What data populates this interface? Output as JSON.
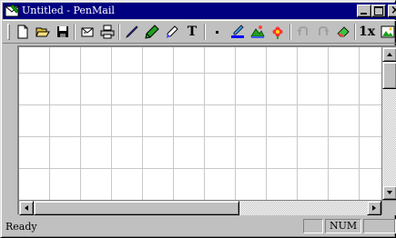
{
  "window": {
    "title": "Untitled - PenMail"
  },
  "toolbar": {
    "buttons": [
      {
        "name": "new-button",
        "icon": "new-document-icon"
      },
      {
        "name": "open-button",
        "icon": "open-folder-icon"
      },
      {
        "name": "save-button",
        "icon": "floppy-disk-icon"
      },
      {
        "name": "mail-button",
        "icon": "envelope-icon"
      },
      {
        "name": "print-button",
        "icon": "printer-icon"
      },
      {
        "name": "pen-button",
        "icon": "pen-icon"
      },
      {
        "name": "pencil-button",
        "icon": "pencil-icon"
      },
      {
        "name": "marker-button",
        "icon": "marker-icon"
      },
      {
        "name": "text-button",
        "icon": "text-icon",
        "label": "T"
      },
      {
        "name": "dot-size-button",
        "icon": "dot-icon"
      },
      {
        "name": "line-color-button",
        "icon": "line-color-icon"
      },
      {
        "name": "picture-button",
        "icon": "picture-icon"
      },
      {
        "name": "stamp-button",
        "icon": "flower-stamp-icon"
      },
      {
        "name": "undo-button",
        "icon": "undo-icon"
      },
      {
        "name": "redo-button",
        "icon": "redo-icon"
      },
      {
        "name": "eraser-button",
        "icon": "eraser-icon"
      },
      {
        "name": "zoom-button",
        "icon": "zoom-icon",
        "label": "1x"
      },
      {
        "name": "extra-button",
        "icon": "image-icon"
      }
    ]
  },
  "status": {
    "text": "Ready",
    "num": "NUM"
  },
  "colors": {
    "titlebar": "#000080",
    "face": "#c0c0c0",
    "grid": "#c8c8c8"
  }
}
